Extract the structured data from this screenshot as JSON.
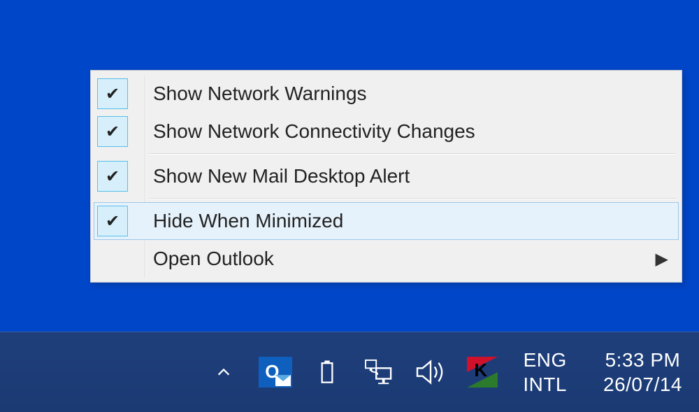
{
  "menu": {
    "items": [
      {
        "label": "Show Network Warnings",
        "checked": true,
        "submenu": false,
        "hover": false
      },
      {
        "label": "Show Network Connectivity Changes",
        "checked": true,
        "submenu": false,
        "hover": false
      },
      {
        "sep": true
      },
      {
        "label": "Show New Mail Desktop Alert",
        "checked": true,
        "submenu": false,
        "hover": false
      },
      {
        "sep": true
      },
      {
        "label": "Hide When Minimized",
        "checked": true,
        "submenu": false,
        "hover": true
      },
      {
        "label": "Open Outlook",
        "checked": false,
        "submenu": true,
        "hover": false
      }
    ]
  },
  "tray": {
    "lang_line1": "ENG",
    "lang_line2": "INTL",
    "time": "5:33 PM",
    "date": "26/07/14",
    "icons": {
      "chevron": "show-hidden-icons",
      "outlook": "outlook-tray-icon",
      "battery": "battery-icon",
      "network": "network-icon",
      "volume": "volume-icon",
      "kaspersky": "kaspersky-icon"
    }
  }
}
